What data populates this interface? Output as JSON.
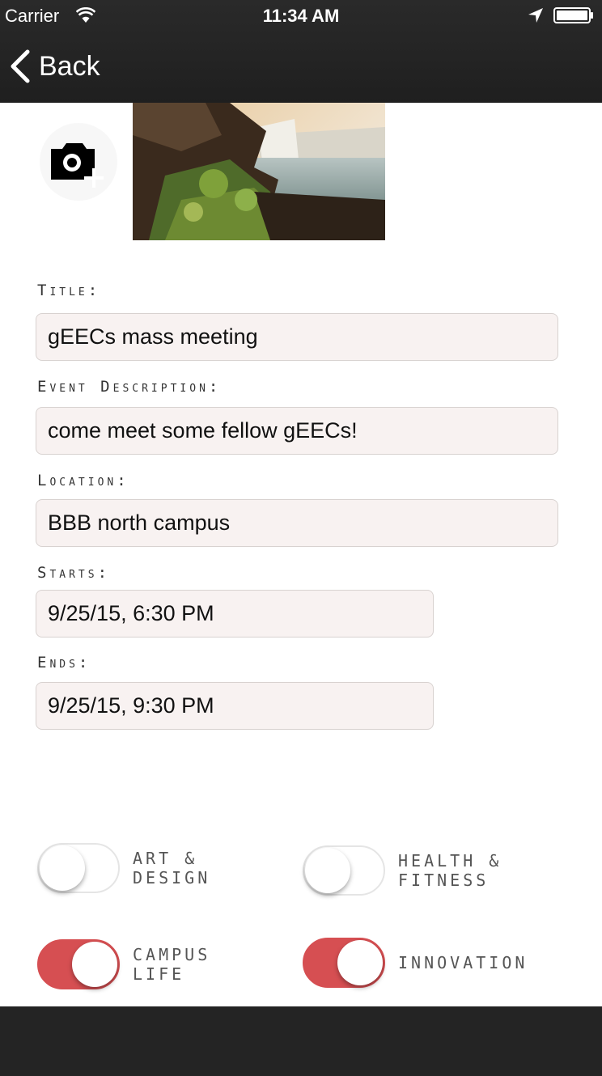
{
  "status_bar": {
    "carrier": "Carrier",
    "time": "11:34 AM"
  },
  "nav": {
    "back_label": "Back"
  },
  "colors": {
    "nav_background": "#222222",
    "field_background": "#f8f2f1",
    "toggle_on": "#d64f52"
  },
  "icons": {
    "camera": "camera-add-icon",
    "back": "chevron-left-icon"
  },
  "form": {
    "title_label": "Title:",
    "title_value": "gEECs mass meeting",
    "description_label": "Event Description:",
    "description_value": "come meet some fellow gEECs!",
    "location_label": "Location:",
    "location_value": "BBB north campus",
    "starts_label": "Starts:",
    "starts_value": "9/25/15, 6:30 PM",
    "ends_label": "Ends:",
    "ends_value": "9/25/15, 9:30 PM"
  },
  "categories": [
    {
      "label": "ART &\nDESIGN",
      "on": false
    },
    {
      "label": "HEALTH &\nFITNESS",
      "on": false
    },
    {
      "label": "CAMPUS\nLIFE",
      "on": true
    },
    {
      "label": "INNOVATION",
      "on": true
    }
  ]
}
